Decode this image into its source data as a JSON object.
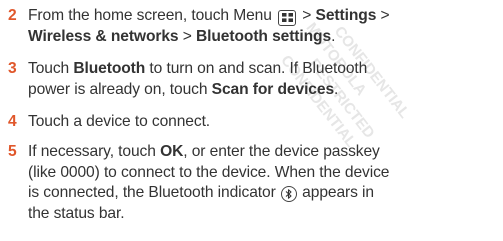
{
  "steps": [
    {
      "num": "2",
      "l1a": "From the home screen, touch Menu",
      "l1b": " > ",
      "l1c": "Settings",
      "l1d": " >",
      "l2a": "Wireless & networks",
      "l2b": " > ",
      "l2c": "Bluetooth settings",
      "l2d": "."
    },
    {
      "num": "3",
      "l1a": "Touch ",
      "l1b": "Bluetooth",
      "l1c": " to turn on and scan. If Bluetooth",
      "l2a": "power is already on, touch ",
      "l2b": "Scan for devices",
      "l2c": "."
    },
    {
      "num": "4",
      "l1a": "Touch a device to connect."
    },
    {
      "num": "5",
      "l1a": "If necessary, touch ",
      "l1b": "OK",
      "l1c": ", or enter the device passkey",
      "l2a": "(like 0000) to connect to the device. When the device",
      "l3a": "is connected, the Bluetooth indicator",
      "l3b": " appears in",
      "l4a": "the status bar."
    }
  ],
  "icons": {
    "menu": "menu-key-icon",
    "bluetooth": "bluetooth-indicator-icon"
  },
  "colors": {
    "step_number": "#e0572b",
    "text": "#333333",
    "watermark": "#e3e3e3"
  }
}
